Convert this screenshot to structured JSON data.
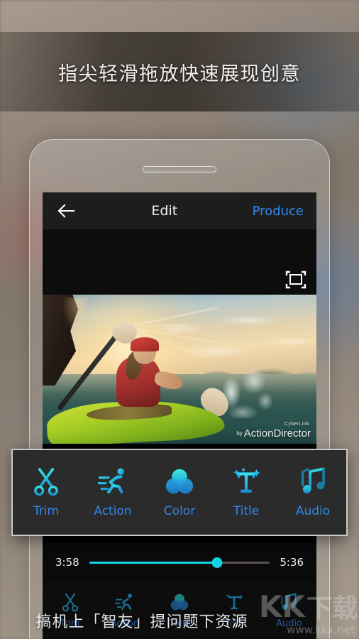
{
  "headline": "指尖轻滑拖放快速展现创意",
  "app": {
    "header": {
      "back_icon": "back-arrow-icon",
      "title": "Edit",
      "produce_label": "Produce"
    },
    "preview": {
      "fullscreen_icon": "fullscreen-icon",
      "video_watermark": {
        "brand": "CyberLink",
        "by": "by",
        "product": "ActionDirector"
      }
    },
    "timeline": {
      "current_time": "3:58",
      "total_time": "5:36",
      "progress_percent": 71
    },
    "edit_panel": {
      "items": [
        {
          "label": "Trim",
          "icon": "scissors-icon"
        },
        {
          "label": "Action",
          "icon": "running-person-icon"
        },
        {
          "label": "Color",
          "icon": "color-circles-icon"
        },
        {
          "label": "Title",
          "icon": "title-text-icon"
        },
        {
          "label": "Audio",
          "icon": "music-note-icon"
        }
      ]
    },
    "bottom_bar": {
      "items": [
        {
          "label": "Trim",
          "icon": "scissors-icon"
        },
        {
          "label": "Action",
          "icon": "running-person-icon"
        },
        {
          "label": "Color",
          "icon": "color-circles-icon"
        },
        {
          "label": "Title",
          "icon": "title-text-icon"
        },
        {
          "label": "Audio",
          "icon": "music-note-icon"
        }
      ]
    }
  },
  "watermarks": {
    "chinese_promo": "搞机上「智友」提问题下资源",
    "site_logo_latin": "KK",
    "site_logo_cn": "下载",
    "site_url": "www.kkx.net"
  },
  "colors": {
    "accent_blue": "#2f87ef",
    "accent_cyan": "#12d3e4",
    "icon_cyan": "#1fc5f0",
    "panel_bg": "#2b2b2b",
    "screen_bg": "#0d0d0d",
    "header_bg": "#1d1d1d"
  }
}
